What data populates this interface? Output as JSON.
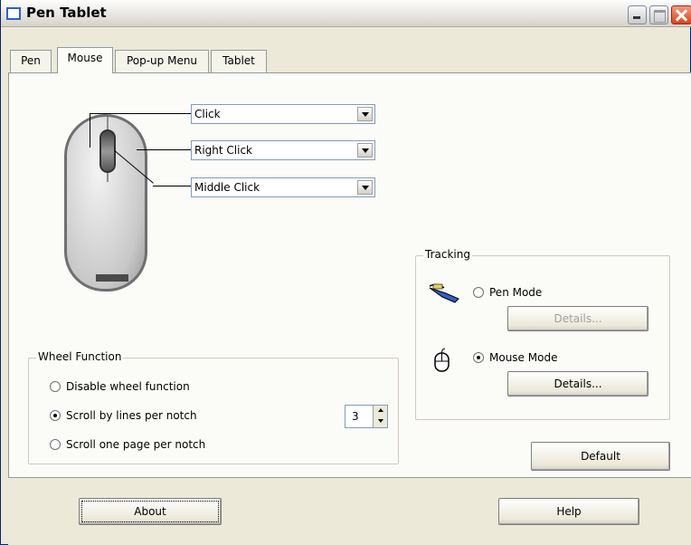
{
  "window": {
    "title": "Pen Tablet"
  },
  "tabs": [
    {
      "label": "Pen",
      "active": false
    },
    {
      "label": "Mouse",
      "active": true
    },
    {
      "label": "Pop-up Menu",
      "active": false
    },
    {
      "label": "Tablet",
      "active": false
    }
  ],
  "button_assignments": {
    "left_button": "Click",
    "right_button": "Right Click",
    "middle_button": "Middle Click"
  },
  "wheel_function": {
    "legend": "Wheel Function",
    "options": [
      {
        "label": "Disable wheel function",
        "selected": false
      },
      {
        "label": "Scroll by lines per notch",
        "selected": true
      },
      {
        "label": "Scroll one page per notch",
        "selected": false
      }
    ],
    "lines_per_notch": "3"
  },
  "tracking": {
    "legend": "Tracking",
    "pen_mode": {
      "label": "Pen Mode",
      "selected": false,
      "details_label": "Details...",
      "details_enabled": false
    },
    "mouse_mode": {
      "label": "Mouse Mode",
      "selected": true,
      "details_label": "Details...",
      "details_enabled": true
    }
  },
  "buttons": {
    "default_label": "Default",
    "about_label": "About",
    "help_label": "Help"
  },
  "icons": {
    "pen": "pen-icon",
    "mouse": "mouse-icon"
  }
}
